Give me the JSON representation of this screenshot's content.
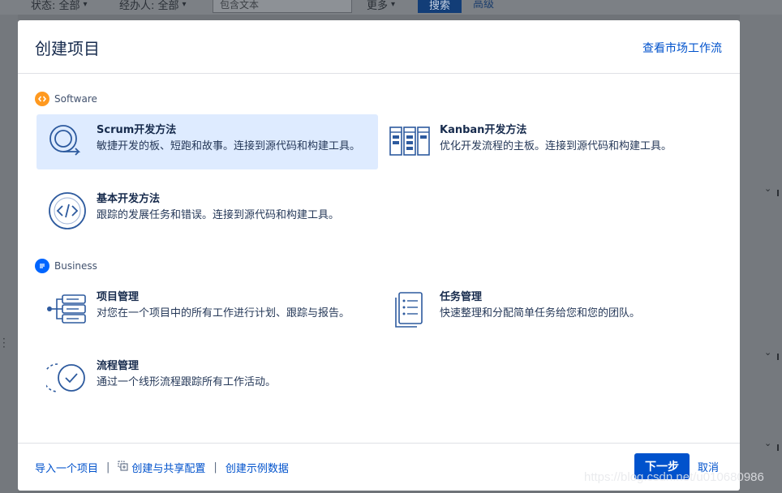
{
  "background": {
    "status_filter": "状态: 全部",
    "assignee_filter": "经办人: 全部",
    "text_input_placeholder": "包含文本",
    "more_label": "更多",
    "search_label": "搜索",
    "advanced_label": "高级"
  },
  "modal": {
    "title": "创建项目",
    "marketplace_link": "查看市场工作流",
    "sections": {
      "software": {
        "label": "Software",
        "color": "#ff991f",
        "options": {
          "scrum": {
            "name": "Scrum开发方法",
            "desc": "敏捷开发的板、短跑和故事。连接到源代码和构建工具。",
            "selected": true
          },
          "kanban": {
            "name": "Kanban开发方法",
            "desc": "优化开发流程的主板。连接到源代码和构建工具。"
          },
          "basic": {
            "name": "基本开发方法",
            "desc": "跟踪的发展任务和错误。连接到源代码和构建工具。"
          }
        }
      },
      "business": {
        "label": "Business",
        "color": "#0065ff",
        "options": {
          "project": {
            "name": "项目管理",
            "desc": "对您在一个项目中的所有工作进行计划、跟踪与报告。"
          },
          "task": {
            "name": "任务管理",
            "desc": "快速整理和分配简单任务给您和您的团队。"
          },
          "process": {
            "name": "流程管理",
            "desc": "通过一个线形流程跟踪所有工作活动。"
          }
        }
      }
    },
    "footer": {
      "import_link": "导入一个项目",
      "shared_config_link": "创建与共享配置",
      "sample_data_link": "创建示例数据",
      "separator": "|",
      "next_button": "下一步",
      "cancel_link": "取消"
    }
  },
  "watermark": "https://blog.csdn.net/u010680986",
  "colors": {
    "primary": "#0052cc",
    "selected_bg": "#deebff",
    "text": "#172b4d",
    "icon_blue": "#2d5a9e"
  }
}
